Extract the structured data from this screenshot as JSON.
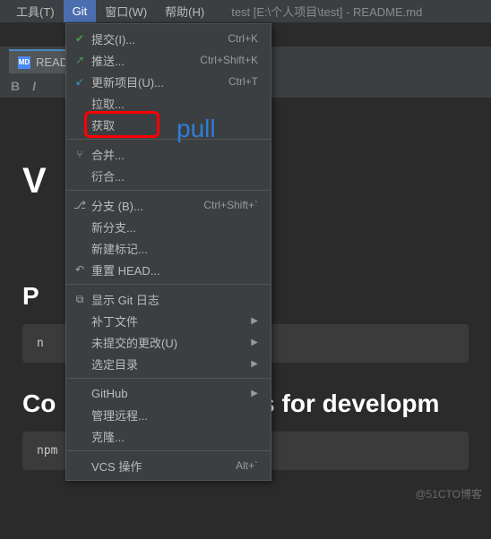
{
  "menubar": {
    "tools": "工具(T)",
    "git": "Git",
    "window": "窗口(W)",
    "help": "帮助(H)"
  },
  "window_title": "test [E:\\个人项目\\test] - README.md",
  "tab": {
    "label": "README.md",
    "icon": "MD"
  },
  "toolbar": {
    "bold": "B",
    "italic": "I"
  },
  "editor": {
    "h1_line": "V",
    "h2_line1": "P",
    "code1_partial": "n",
    "h2_line2_prefix": "Co",
    "h2_line2_suffix": "loads for developm",
    "code2": "npm run serve"
  },
  "git_menu": {
    "commit": {
      "label": "提交(I)...",
      "shortcut": "Ctrl+K"
    },
    "push": {
      "label": "推送...",
      "shortcut": "Ctrl+Shift+K"
    },
    "update": {
      "label": "更新项目(U)...",
      "shortcut": "Ctrl+T"
    },
    "pull": {
      "label": "拉取..."
    },
    "fetch": {
      "label": "获取"
    },
    "merge": {
      "label": "合并..."
    },
    "rebase": {
      "label": "衍合..."
    },
    "branches": {
      "label": "分支 (B)...",
      "shortcut": "Ctrl+Shift+`"
    },
    "new_branch": {
      "label": "新分支..."
    },
    "new_tag": {
      "label": "新建标记..."
    },
    "reset": {
      "label": "重置 HEAD..."
    },
    "show_log": {
      "label": "显示 Git 日志"
    },
    "patch": {
      "label": "补丁文件"
    },
    "uncommitted": {
      "label": "未提交的更改(U)"
    },
    "select_dir": {
      "label": "选定目录"
    },
    "github": {
      "label": "GitHub"
    },
    "manage_remote": {
      "label": "管理远程..."
    },
    "clone": {
      "label": "克隆..."
    },
    "vcs_ops": {
      "label": "VCS 操作",
      "shortcut": "Alt+`"
    }
  },
  "annotation": {
    "pull": "pull"
  },
  "watermark": "@51CTO博客"
}
